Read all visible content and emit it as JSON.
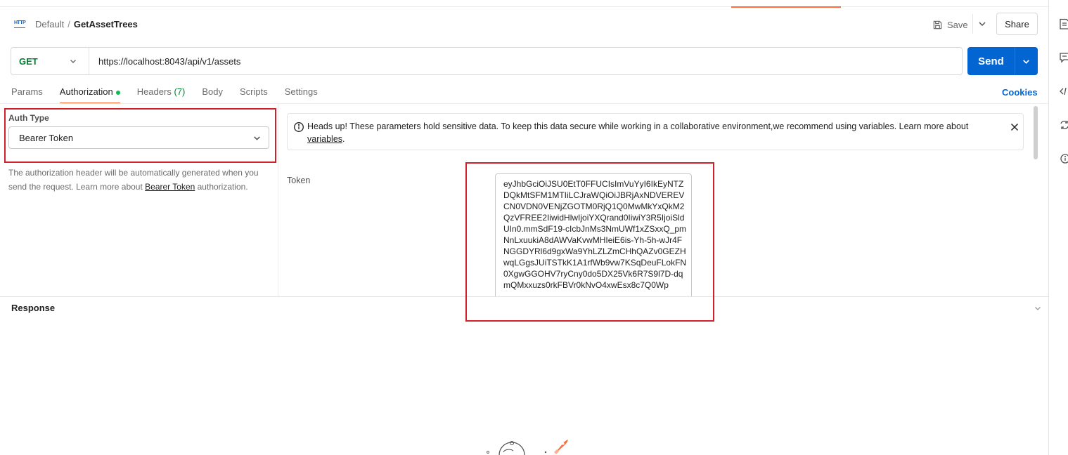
{
  "header": {
    "protocol_badge": "HTTP",
    "breadcrumb_parent": "Default",
    "breadcrumb_separator": "/",
    "request_name": "GetAssetTrees",
    "save_label": "Save",
    "share_label": "Share"
  },
  "request": {
    "method": "GET",
    "url": "https://localhost:8043/api/v1/assets",
    "send_label": "Send"
  },
  "tabs": {
    "params": "Params",
    "authorization": "Authorization",
    "headers": "Headers",
    "headers_count": "(7)",
    "body": "Body",
    "scripts": "Scripts",
    "settings": "Settings",
    "cookies": "Cookies"
  },
  "auth": {
    "type_label": "Auth Type",
    "type_value": "Bearer Token",
    "desc_prefix": "The authorization header will be automatically generated when you send the request. Learn more about ",
    "desc_link": "Bearer Token",
    "desc_suffix": " authorization."
  },
  "warning": {
    "message": "Heads up! These parameters hold sensitive data. To keep this data secure while working in a collaborative environment,we recommend using variables. Learn more about ",
    "link": "variables",
    "suffix": "."
  },
  "token": {
    "label": "Token",
    "value": "eyJhbGciOiJSU0EtT0FFUCIsImVuYyI6IkEyNTZDQkMtSFM1MTIiLCJraWQiOiJBRjAxNDVEREVCN0VDN0VENjZGOTM0RjQ1Q0MwMkYxQkM2QzVFREE2IiwidHlwIjoiYXQrand0IiwiY3R5IjoiSldUIn0.mmSdF19-cIcbJnMs3NmUWf1xZSxxQ_pmNnLxuukiA8dAWVaKvwMHIeiE6is-Yh-5h-wJr4FNGGDYRl6d9gxWa9YhLZLZmCHhQAZv0GEZHwqLGgsJUiTSTkK1A1rfWb9vw7KSqDeuFLokFN0XgwGGOHV7ryCny0do5DX25Vk6R7S9l7D-dqmQMxxuzs0rkFBVr0kNvO4xwEsx8c7Q0Wp"
  },
  "response": {
    "title": "Response"
  },
  "colors": {
    "accent": "#ff6c37",
    "send": "#0265d2",
    "method_get": "#007f31",
    "highlight": "#d0202a"
  }
}
